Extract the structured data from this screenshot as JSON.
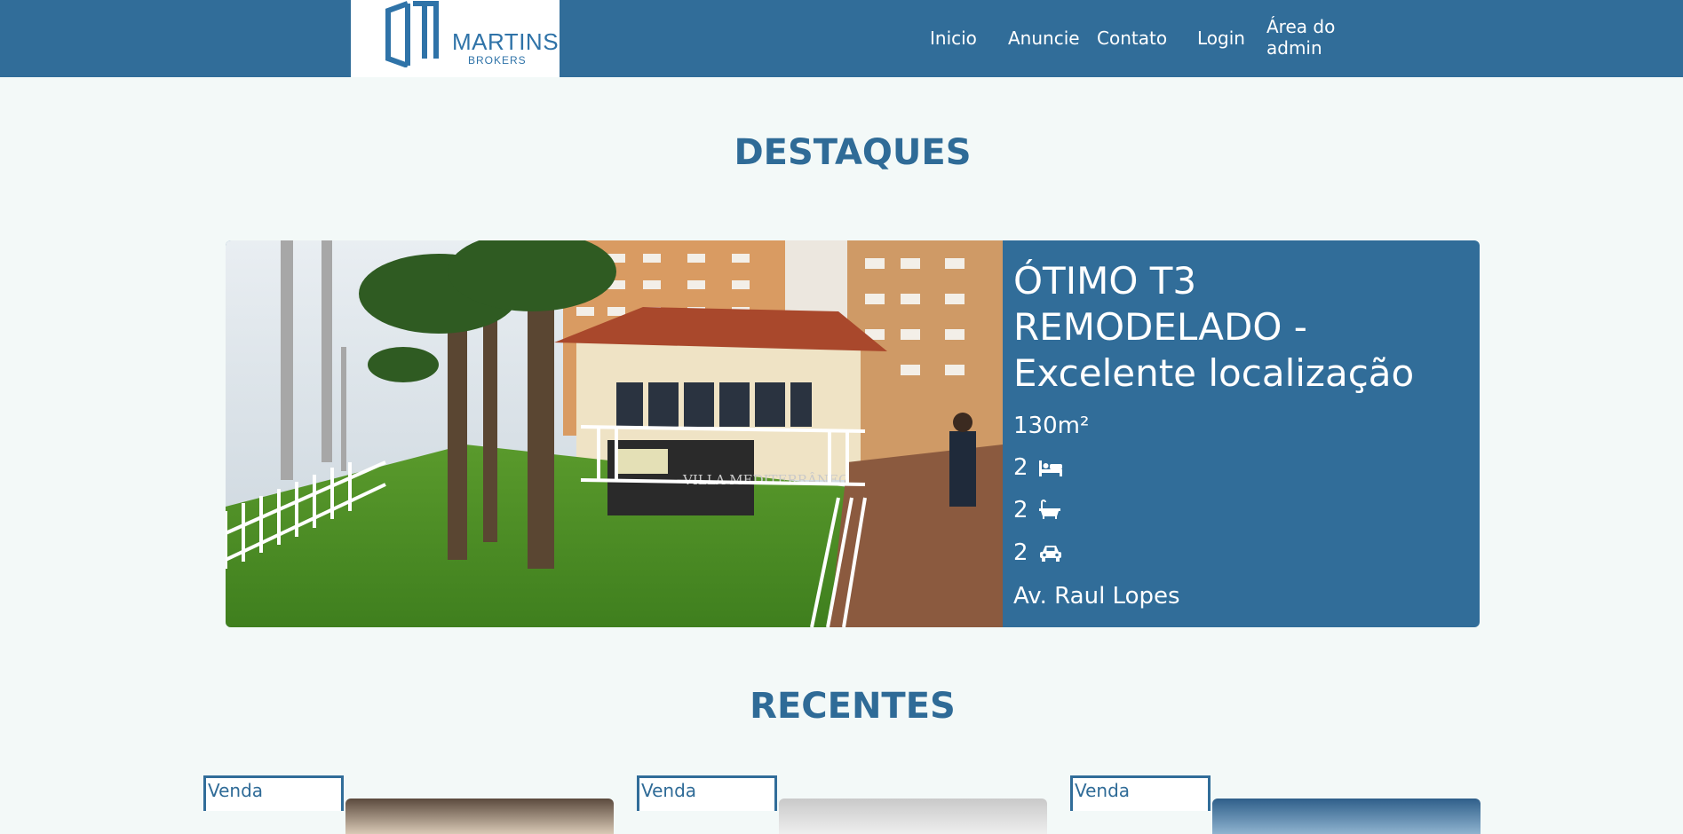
{
  "brand": {
    "name": "MARTINS",
    "tagline": "BROKERS"
  },
  "nav": {
    "inicio": "Inicio",
    "anuncie": "Anuncie",
    "contato": "Contato",
    "login": "Login",
    "admin": "Área do admin"
  },
  "sections": {
    "featured": "DESTAQUES",
    "recent": "RECENTES"
  },
  "featured": {
    "title": "ÓTIMO T3 REMODELADO - Excelente localização",
    "area": "130m²",
    "bedrooms": "2",
    "bathrooms": "2",
    "parking": "2",
    "address": "Av. Raul Lopes",
    "photo_sign": "VILLA MEDITERRÂNEO"
  },
  "recent": [
    {
      "badge": "Venda"
    },
    {
      "badge": "Venda"
    },
    {
      "badge": "Venda"
    }
  ],
  "icons": {
    "bedrooms": "bed-icon",
    "bathrooms": "bath-icon",
    "parking": "car-icon"
  },
  "colors": {
    "primary": "#316d99",
    "heading": "#2f6b97",
    "background": "#f3f9f8",
    "logo": "#2f73a8"
  }
}
